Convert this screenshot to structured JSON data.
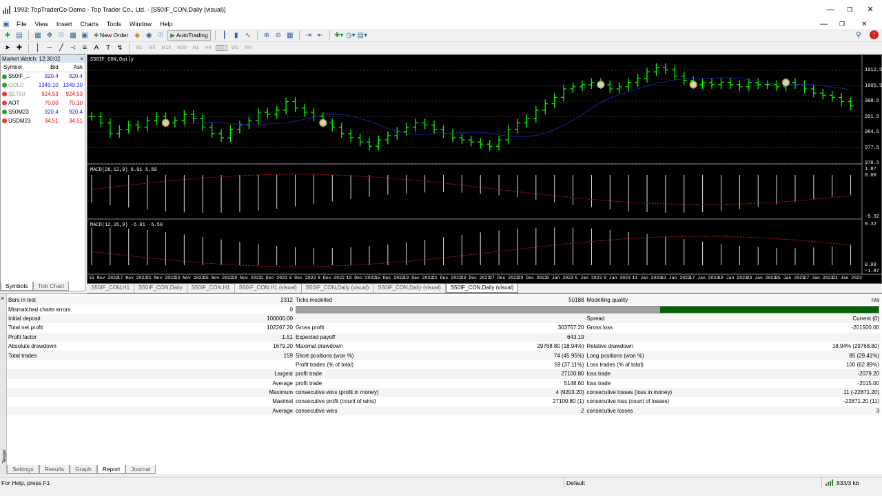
{
  "window": {
    "title": "1993: TopTraderCo-Demo - Top Trader Co., Ltd. - [S50IF_CON,Daily (visual)]"
  },
  "menu": [
    "File",
    "View",
    "Insert",
    "Charts",
    "Tools",
    "Window",
    "Help"
  ],
  "toolbar": {
    "new_order": "New Order",
    "autotrading": "AutoTrading"
  },
  "timeframes": [
    "M1",
    "M5",
    "M15",
    "M30",
    "H1",
    "H4",
    "D1",
    "W1",
    "MN"
  ],
  "market_watch": {
    "title": "Market Watch: 12:30:02",
    "headers": [
      "Symbol",
      "Bid",
      "Ask"
    ],
    "rows": [
      {
        "symbol": "S50IF_...",
        "bid": "920.4",
        "ask": "920.4",
        "color": "#1a1aff",
        "dot": "#2e9e2e"
      },
      {
        "symbol": "GOLD",
        "bid": "1349.10",
        "ask": "1349.10",
        "color": "#1a1aff",
        "dot": "#2e9e2e",
        "muted": true
      },
      {
        "symbol": "SET50",
        "bid": "924.53",
        "ask": "924.53",
        "color": "#e00000",
        "dot": "#e04040",
        "muted": true
      },
      {
        "symbol": "AOT",
        "bid": "70.00",
        "ask": "70.10",
        "color": "#e00000",
        "dot": "#e04040"
      },
      {
        "symbol": "S50M23",
        "bid": "920.4",
        "ask": "920.4",
        "color": "#1a1aff",
        "dot": "#2e9e2e"
      },
      {
        "symbol": "USDM23",
        "bid": "34.51",
        "ask": "34.51",
        "color": "#e00000",
        "dot": "#e04040"
      }
    ],
    "tabs": [
      "Symbols",
      "Tick Chart"
    ]
  },
  "chart": {
    "symbol_label": "S50IF_CON,Daily",
    "price_ticks": [
      "1012.5",
      "1005.5",
      "998.5",
      "991.5",
      "984.5",
      "977.5",
      "970.5"
    ],
    "macd1_label": "MACD(26,12,9) 6.01 5.50",
    "macd1_ticks": [
      "1.87",
      "0.00",
      "-9.32"
    ],
    "macd2_label": "MACD(12,26,9) -6.01 -5.50",
    "macd2_ticks": [
      "9.32",
      "0.00",
      "-1.87"
    ],
    "dates": [
      "15 Nov 2022",
      "17 Nov 2022",
      "21 Nov 2022",
      "23 Nov 2022",
      "25 Nov 2022",
      "29 Nov 2022",
      "1 Dec 2022",
      "6 Dec 2022",
      "8 Dec 2022",
      "13 Dec 2022",
      "15 Dec 2022",
      "19 Dec 2022",
      "21 Dec 2022",
      "23 Dec 2022",
      "27 Dec 2022",
      "29 Dec 2022",
      "3 Jan 2023",
      "5 Jan 2023",
      "9 Jan 2023",
      "11 Jan 2023",
      "13 Jan 2023",
      "17 Jan 2023",
      "19 Jan 2023",
      "23 Jan 2023",
      "25 Jan 2023",
      "27 Jan 2023",
      "31 Jan 2023"
    ],
    "closes": [
      990,
      987,
      982,
      984,
      986,
      985,
      988,
      990,
      987,
      988,
      991,
      989,
      985,
      982,
      980,
      984,
      986,
      988,
      992,
      991,
      993,
      997,
      994,
      992,
      990,
      987,
      985,
      982,
      980,
      978,
      976,
      979,
      981,
      983,
      985,
      987,
      986,
      984,
      982,
      980,
      979,
      978,
      977,
      976,
      979,
      984,
      987,
      989,
      993,
      996,
      999,
      1003,
      1004,
      1005,
      1006,
      1005,
      1003,
      1004,
      1006,
      1008,
      1011,
      1013,
      1012,
      1009,
      1007,
      1005,
      1006,
      1005,
      1006,
      1005,
      1004,
      1006,
      1005,
      1005,
      1004,
      1006,
      1005,
      1003,
      1001,
      1000,
      999,
      997,
      995
    ]
  },
  "chart_tabs": [
    "S50IF_CON,H1",
    "S50IF_CON,Daily",
    "S50IF_CON,H1",
    "S50IF_CON,H1 (visual)",
    "S50IF_CON,Daily (visual)",
    "S50IF_CON,Daily (visual)",
    "S50IF_CON,Daily (visual)"
  ],
  "report": {
    "bars_in_test": "Bars in test",
    "bars_in_test_v": "2312",
    "ticks_modelled": "Ticks modelled",
    "ticks_modelled_v": "50188",
    "modelling_quality": "Modelling quality",
    "modelling_quality_v": "n/a",
    "mismatched": "Mismatched charts errors",
    "mismatched_v": "0",
    "initial_deposit": "Initial deposit",
    "initial_deposit_v": "100000.00",
    "spread": "Spread",
    "spread_v": "Current (0)",
    "total_net_profit": "Total net profit",
    "total_net_profit_v": "102267.20",
    "gross_profit": "Gross profit",
    "gross_profit_v": "303767.20",
    "gross_loss": "Gross loss",
    "gross_loss_v": "-201500.00",
    "profit_factor": "Profit factor",
    "profit_factor_v": "1.51",
    "expected_payoff": "Expected payoff",
    "expected_payoff_v": "643.19",
    "absolute_drawdown": "Absolute drawdown",
    "absolute_drawdown_v": "1679.20",
    "maximal_drawdown": "Maximal drawdown",
    "maximal_drawdown_v": "29768.80 (18.94%)",
    "relative_drawdown": "Relative drawdown",
    "relative_drawdown_v": "18.94% (29768.80)",
    "total_trades": "Total trades",
    "total_trades_v": "159",
    "short_positions": "Short positions (won %)",
    "short_positions_v": "74 (45.95%)",
    "long_positions": "Long positions (won %)",
    "long_positions_v": "85 (29.41%)",
    "profit_trades": "Profit trades (% of total)",
    "profit_trades_v": "59 (37.11%)",
    "loss_trades": "Loss trades (% of total)",
    "loss_trades_v": "100 (62.89%)",
    "largest": "Largest",
    "largest_pt": "profit trade",
    "largest_pt_v": "27100.80",
    "largest_lt": "loss trade",
    "largest_lt_v": "-2079.20",
    "average": "Average",
    "average_pt": "profit trade",
    "average_pt_v": "5148.60",
    "average_lt": "loss trade",
    "average_lt_v": "-2015.00",
    "maximum": "Maximum",
    "max_cw": "consecutive wins (profit in money)",
    "max_cw_v": "4 (9203.20)",
    "max_cl": "consecutive losses (loss in money)",
    "max_cl_v": "11 (-22871.20)",
    "maximal": "Maximal",
    "mx_cp": "consecutive profit (count of wins)",
    "mx_cp_v": "27100.80 (1)",
    "mx_cl": "consecutive loss (count of losses)",
    "mx_cl_v": "-22871.20 (11)",
    "average2": "Average",
    "av_cw": "consecutive wins",
    "av_cw_v": "2",
    "av_cl": "consecutive losses",
    "av_cl_v": "3",
    "progress": 0.625
  },
  "tester_label": "Tester",
  "tester_tabs": [
    "Settings",
    "Results",
    "Graph",
    "Report",
    "Journal"
  ],
  "status": {
    "help": "For Help, press F1",
    "profile": "Default",
    "traffic": "833/3 kb"
  },
  "colors": {
    "candle_up": "#00ff00",
    "chart_bg": "#000000",
    "ma_line": "#1e1ea0",
    "macd_signal": "#c81e1e",
    "progress_fill": "#006400"
  }
}
